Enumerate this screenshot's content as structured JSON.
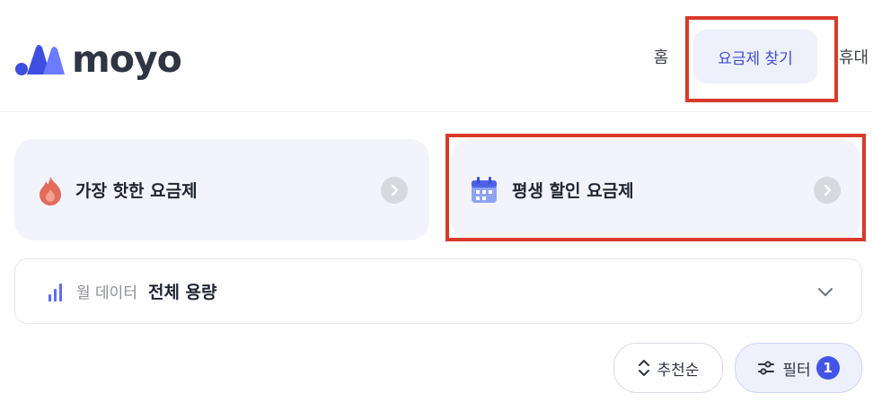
{
  "header": {
    "logo_text": "moyo",
    "nav": {
      "home": "홈",
      "find_plan": "요금제 찾기",
      "phone": "휴대"
    }
  },
  "promos": [
    {
      "label": "가장 핫한 요금제",
      "icon": "fire-icon"
    },
    {
      "label": "평생 할인 요금제",
      "icon": "calendar-icon"
    }
  ],
  "data_filter": {
    "label": "월 데이터",
    "value": "전체 용량",
    "icon": "bar-chart-icon"
  },
  "controls": {
    "sort_label": "추천순",
    "filter_label": "필터",
    "filter_count": "1"
  },
  "colors": {
    "accent": "#4354e8",
    "highlight": "#d93a2b",
    "card_bg": "#f3f4fb"
  }
}
